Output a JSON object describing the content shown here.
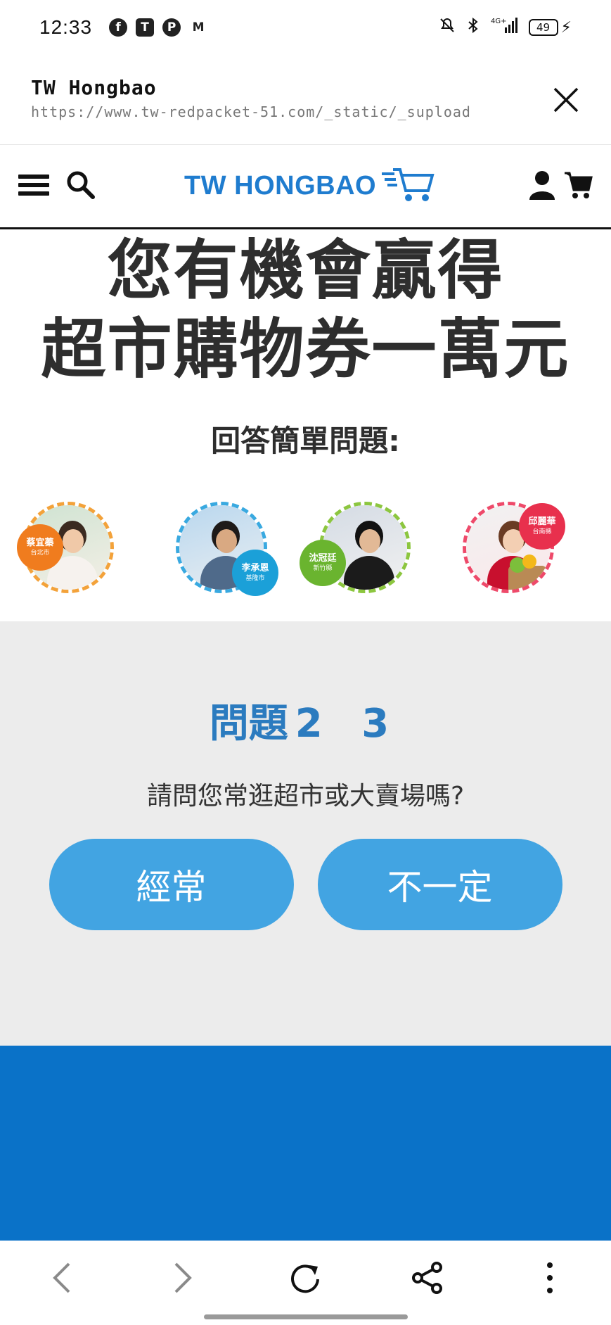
{
  "status_bar": {
    "time": "12:33",
    "app_icons": [
      "facebook-icon",
      "teams-icon",
      "pinterest-icon",
      "gmail-icon"
    ],
    "battery_level": "49",
    "signal": "4G+"
  },
  "tab_header": {
    "title": "TW Hongbao",
    "url": "https://www.tw-redpacket-51.com/_static/_supload"
  },
  "site_nav": {
    "logo_text": "TW HONGBAO"
  },
  "hero": {
    "headline_line1": "您有機會贏得",
    "headline_line2": "超市購物券一萬元",
    "subtitle": "回答簡單問題:"
  },
  "winners": [
    {
      "name": "蔡宜蓁",
      "city": "台北市",
      "badge_color": "#f07c1e",
      "ring_color": "#f3a23a"
    },
    {
      "name": "李承恩",
      "city": "基隆市",
      "badge_color": "#1ba0d8",
      "ring_color": "#39a9e0"
    },
    {
      "name": "沈冠廷",
      "city": "新竹縣",
      "badge_color": "#6ab42f",
      "ring_color": "#8cc63f"
    },
    {
      "name": "邱麗華",
      "city": "台南縣",
      "badge_color": "#e8304d",
      "ring_color": "#ee4a6a"
    }
  ],
  "question": {
    "title": "問題",
    "number": "2 3",
    "text": "請問您常逛超市或大賣場嗎?",
    "answers": [
      "經常",
      "不一定"
    ]
  },
  "colors": {
    "accent_blue": "#2b7bbf",
    "button_blue": "#42a4e2",
    "band_blue": "#0a72c8",
    "logo_blue": "#1f7ccf"
  }
}
